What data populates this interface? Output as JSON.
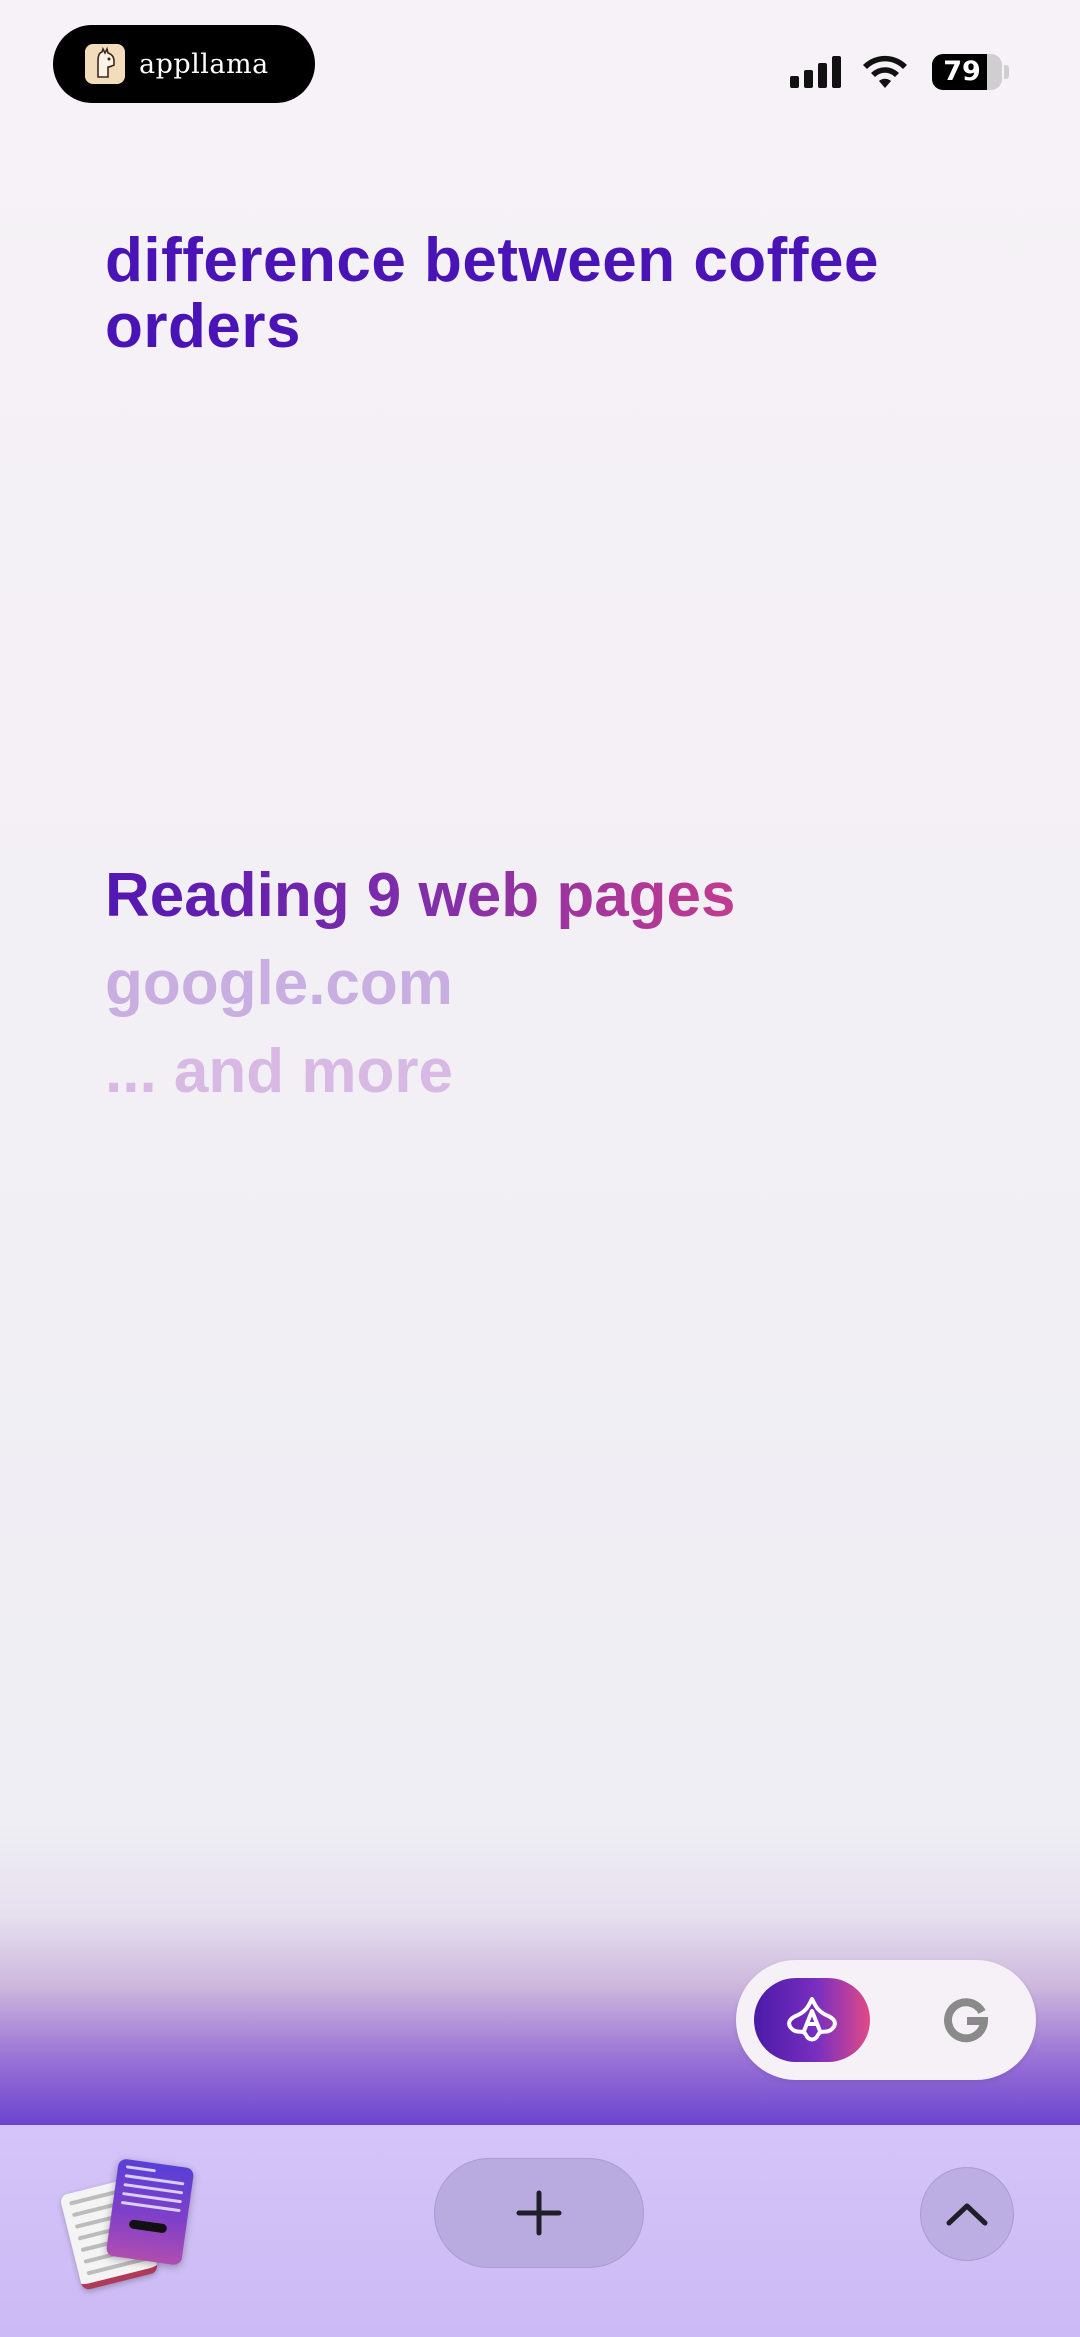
{
  "status_bar": {
    "app_name": "appllama",
    "battery_level": "79",
    "battery_fraction": 0.79,
    "signal_bars": 4
  },
  "query": {
    "title": "difference between coffee orders"
  },
  "progress": {
    "status": "Reading 9 web pages",
    "sources": [
      "google.com",
      "... and more"
    ]
  },
  "mode_toggle": {
    "options": [
      "ai-mode",
      "google"
    ],
    "selected": "ai-mode"
  },
  "bottom_bar": {
    "actions": [
      "tabs",
      "new-tab",
      "scroll-up"
    ]
  },
  "icons": {
    "app_logo": "llama-icon",
    "signal": "cellular-signal-icon",
    "wifi": "wifi-icon",
    "battery": "battery-icon",
    "ai_mode": "sparkle-a-icon",
    "google": "google-g-icon",
    "new_tab": "plus-icon",
    "scroll_up": "chevron-up-icon"
  },
  "colors": {
    "title": "#4a13b5",
    "reading_start": "#5317b2",
    "reading_end": "#c23c8e",
    "source_text": "#c9aee1",
    "bottom_bar": "#d4c4f8",
    "accent_purple": "#4e1fb4"
  }
}
